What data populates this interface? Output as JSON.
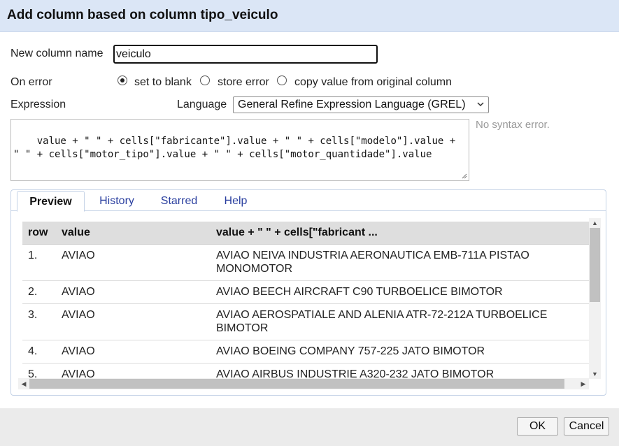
{
  "dialog": {
    "title": "Add column based on column tipo_veiculo"
  },
  "form": {
    "new_column_label": "New column name",
    "new_column_value": "veiculo",
    "on_error_label": "On error",
    "on_error_options": [
      {
        "label": "set to blank",
        "checked": true
      },
      {
        "label": "store error",
        "checked": false
      },
      {
        "label": "copy value from original column",
        "checked": false
      }
    ],
    "expression_label": "Expression",
    "language_label": "Language",
    "language_value": "General Refine Expression Language (GREL)",
    "expression": "value + \" \" + cells[\"fabricante\"].value + \" \" + cells[\"modelo\"].value + \" \" + cells[\"motor_tipo\"].value + \" \" + cells[\"motor_quantidade\"].value",
    "status": "No syntax error."
  },
  "tabs": [
    {
      "label": "Preview",
      "active": true
    },
    {
      "label": "History",
      "active": false
    },
    {
      "label": "Starred",
      "active": false
    },
    {
      "label": "Help",
      "active": false
    }
  ],
  "preview": {
    "columns": [
      "row",
      "value",
      "value + \" \" + cells[\"fabricant ..."
    ],
    "rows": [
      {
        "row": "1.",
        "value": "AVIAO",
        "result": "AVIAO NEIVA INDUSTRIA AERONAUTICA EMB-711A PISTAO MONOMOTOR"
      },
      {
        "row": "2.",
        "value": "AVIAO",
        "result": "AVIAO BEECH AIRCRAFT C90 TURBOELICE BIMOTOR"
      },
      {
        "row": "3.",
        "value": "AVIAO",
        "result": "AVIAO AEROSPATIALE AND ALENIA ATR-72-212A TURBOELICE BIMOTOR"
      },
      {
        "row": "4.",
        "value": "AVIAO",
        "result": "AVIAO BOEING COMPANY 757-225 JATO BIMOTOR"
      },
      {
        "row": "5.",
        "value": "AVIAO",
        "result": "AVIAO AIRBUS INDUSTRIE A320-232 JATO BIMOTOR"
      }
    ]
  },
  "buttons": {
    "ok": "OK",
    "cancel": "Cancel"
  },
  "icons": {
    "select_arrow": "chevron-down-icon",
    "scroll_up": "▲",
    "scroll_down": "▼",
    "scroll_left": "◀",
    "scroll_right": "▶"
  },
  "colors": {
    "titlebar": "#dbe6f6",
    "tab_link": "#2a3f9f",
    "status_text": "#999999"
  }
}
